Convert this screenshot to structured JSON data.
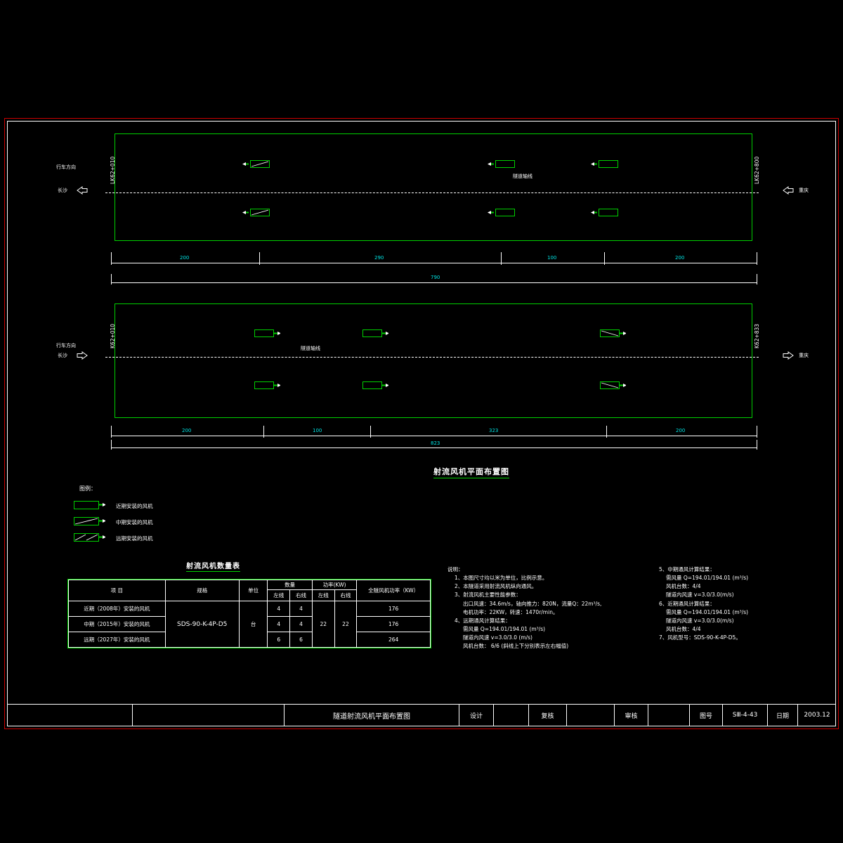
{
  "drawing": {
    "main_title": "射流风机平面布置图",
    "axis_label": "隧道轴线",
    "direction_label": "行车方向"
  },
  "tunnels": [
    {
      "id": "left-tunnel",
      "station_start": "LK62+010",
      "station_end": "LK62+800",
      "dest_left": "长沙",
      "dest_right": "重庆",
      "total_dim": "790",
      "segment_dims": [
        "200",
        "290",
        "100",
        "200"
      ],
      "fans": [
        {
          "type": "mid",
          "arrow": "left"
        },
        {
          "type": "near",
          "arrow": "left"
        },
        {
          "type": "near",
          "arrow": "left"
        }
      ]
    },
    {
      "id": "right-tunnel",
      "station_start": "K62+010",
      "station_end": "K62+833",
      "dest_left": "长沙",
      "dest_right": "重庆",
      "total_dim": "823",
      "segment_dims": [
        "200",
        "100",
        "323",
        "200"
      ],
      "fans": [
        {
          "type": "near",
          "arrow": "right"
        },
        {
          "type": "near",
          "arrow": "right"
        },
        {
          "type": "mid",
          "arrow": "right"
        }
      ]
    }
  ],
  "legend": {
    "title": "图例：",
    "items": [
      {
        "type": "near",
        "label": "近期安装的风机"
      },
      {
        "type": "mid",
        "label": "中期安装的风机"
      },
      {
        "type": "far",
        "label": "远期安装的风机"
      }
    ]
  },
  "table": {
    "title": "射流风机数量表",
    "headers": {
      "item": "项        目",
      "spec": "规格",
      "unit": "单位",
      "qty": "数量",
      "power": "功率(KW)",
      "total": "全隧风机功率（KW）",
      "left_line": "左线",
      "right_line": "右线"
    },
    "rows": [
      {
        "item": "近期（2008年）安装的风机",
        "qty_left": "4",
        "qty_right": "4",
        "total": "176"
      },
      {
        "item": "中期（2015年）安装的风机",
        "qty_left": "4",
        "qty_right": "4",
        "total": "176"
      },
      {
        "item": "远期（2027年）安装的风机",
        "qty_left": "6",
        "qty_right": "6",
        "total": "264"
      }
    ],
    "spec_value": "SDS-90-K-4P-D5",
    "unit_value": "台",
    "power_left": "22",
    "power_right": "22"
  },
  "notes": {
    "heading": "说明：",
    "lines": [
      "1、本图尺寸均以米为单位，比例示意。",
      "2、本隧道采用射流风机纵向通风。",
      "3、射流风机主要性能参数：",
      "出口风速：34.6m/s，轴向推力：820N，流量Q：22m³/s,",
      "电机功率：22KW，转速：1470r/min。",
      "4、远期通风计算结果：",
      "需风量 Q=194.01/194.01 (m³/s)",
      "隧道内风速 v=3.0/3.0 (m/s)",
      "风机台数： 6/6    (斜线上下分别表示左右幅值)"
    ],
    "lines_right": [
      "5、中期通风计算结果：",
      "需风量 Q=194.01/194.01 (m³/s)",
      "风机台数：4/4",
      "隧道内风速 v=3.0/3.0(m/s)",
      "6、近期通风计算结果：",
      "需风量 Q=194.01/194.01 (m³/s)",
      "隧道内风速 v=3.0/3.0(m/s)",
      "风机台数：4/4",
      "7、风机型号：SDS-90-K-4P-D5。"
    ]
  },
  "titleblock": {
    "drawing_name": "隧道射流风机平面布置图",
    "design_label": "设计",
    "design_value": "",
    "review_label": "复核",
    "review_value": "",
    "approve_label": "审核",
    "approve_value": "",
    "number_label": "图号",
    "number_value": "SⅢ-4-43",
    "date_label": "日期",
    "date_value": "2003.12"
  }
}
